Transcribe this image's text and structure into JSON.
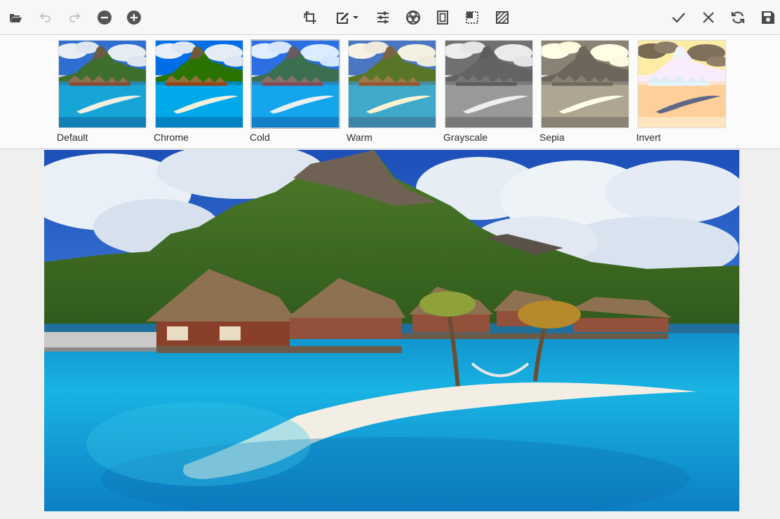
{
  "toolbar": {
    "left": [
      {
        "name": "open-icon",
        "title": "Open"
      },
      {
        "name": "undo-icon",
        "title": "Undo"
      },
      {
        "name": "redo-icon",
        "title": "Redo"
      },
      {
        "name": "zoom-out-icon",
        "title": "Zoom Out"
      },
      {
        "name": "zoom-in-icon",
        "title": "Zoom In"
      }
    ],
    "center": [
      {
        "name": "crop-icon",
        "title": "Crop"
      },
      {
        "name": "annotate-icon",
        "title": "Annotate"
      },
      {
        "name": "adjust-icon",
        "title": "Fine Tune"
      },
      {
        "name": "filter-icon",
        "title": "Filters"
      },
      {
        "name": "frame-icon",
        "title": "Frame"
      },
      {
        "name": "resize-icon",
        "title": "Resize"
      },
      {
        "name": "redact-icon",
        "title": "Redact"
      }
    ],
    "right": [
      {
        "name": "apply-icon",
        "title": "Apply"
      },
      {
        "name": "discard-icon",
        "title": "Discard"
      },
      {
        "name": "reset-icon",
        "title": "Reset"
      },
      {
        "name": "save-icon",
        "title": "Save"
      }
    ],
    "colors": {
      "icon": "#4a4a4a",
      "disabled": "#c4c4c4"
    }
  },
  "filters": {
    "selected": "Cold",
    "items": [
      {
        "label": "Default"
      },
      {
        "label": "Chrome"
      },
      {
        "label": "Cold"
      },
      {
        "label": "Warm"
      },
      {
        "label": "Grayscale"
      },
      {
        "label": "Sepia"
      },
      {
        "label": "Invert"
      }
    ]
  }
}
